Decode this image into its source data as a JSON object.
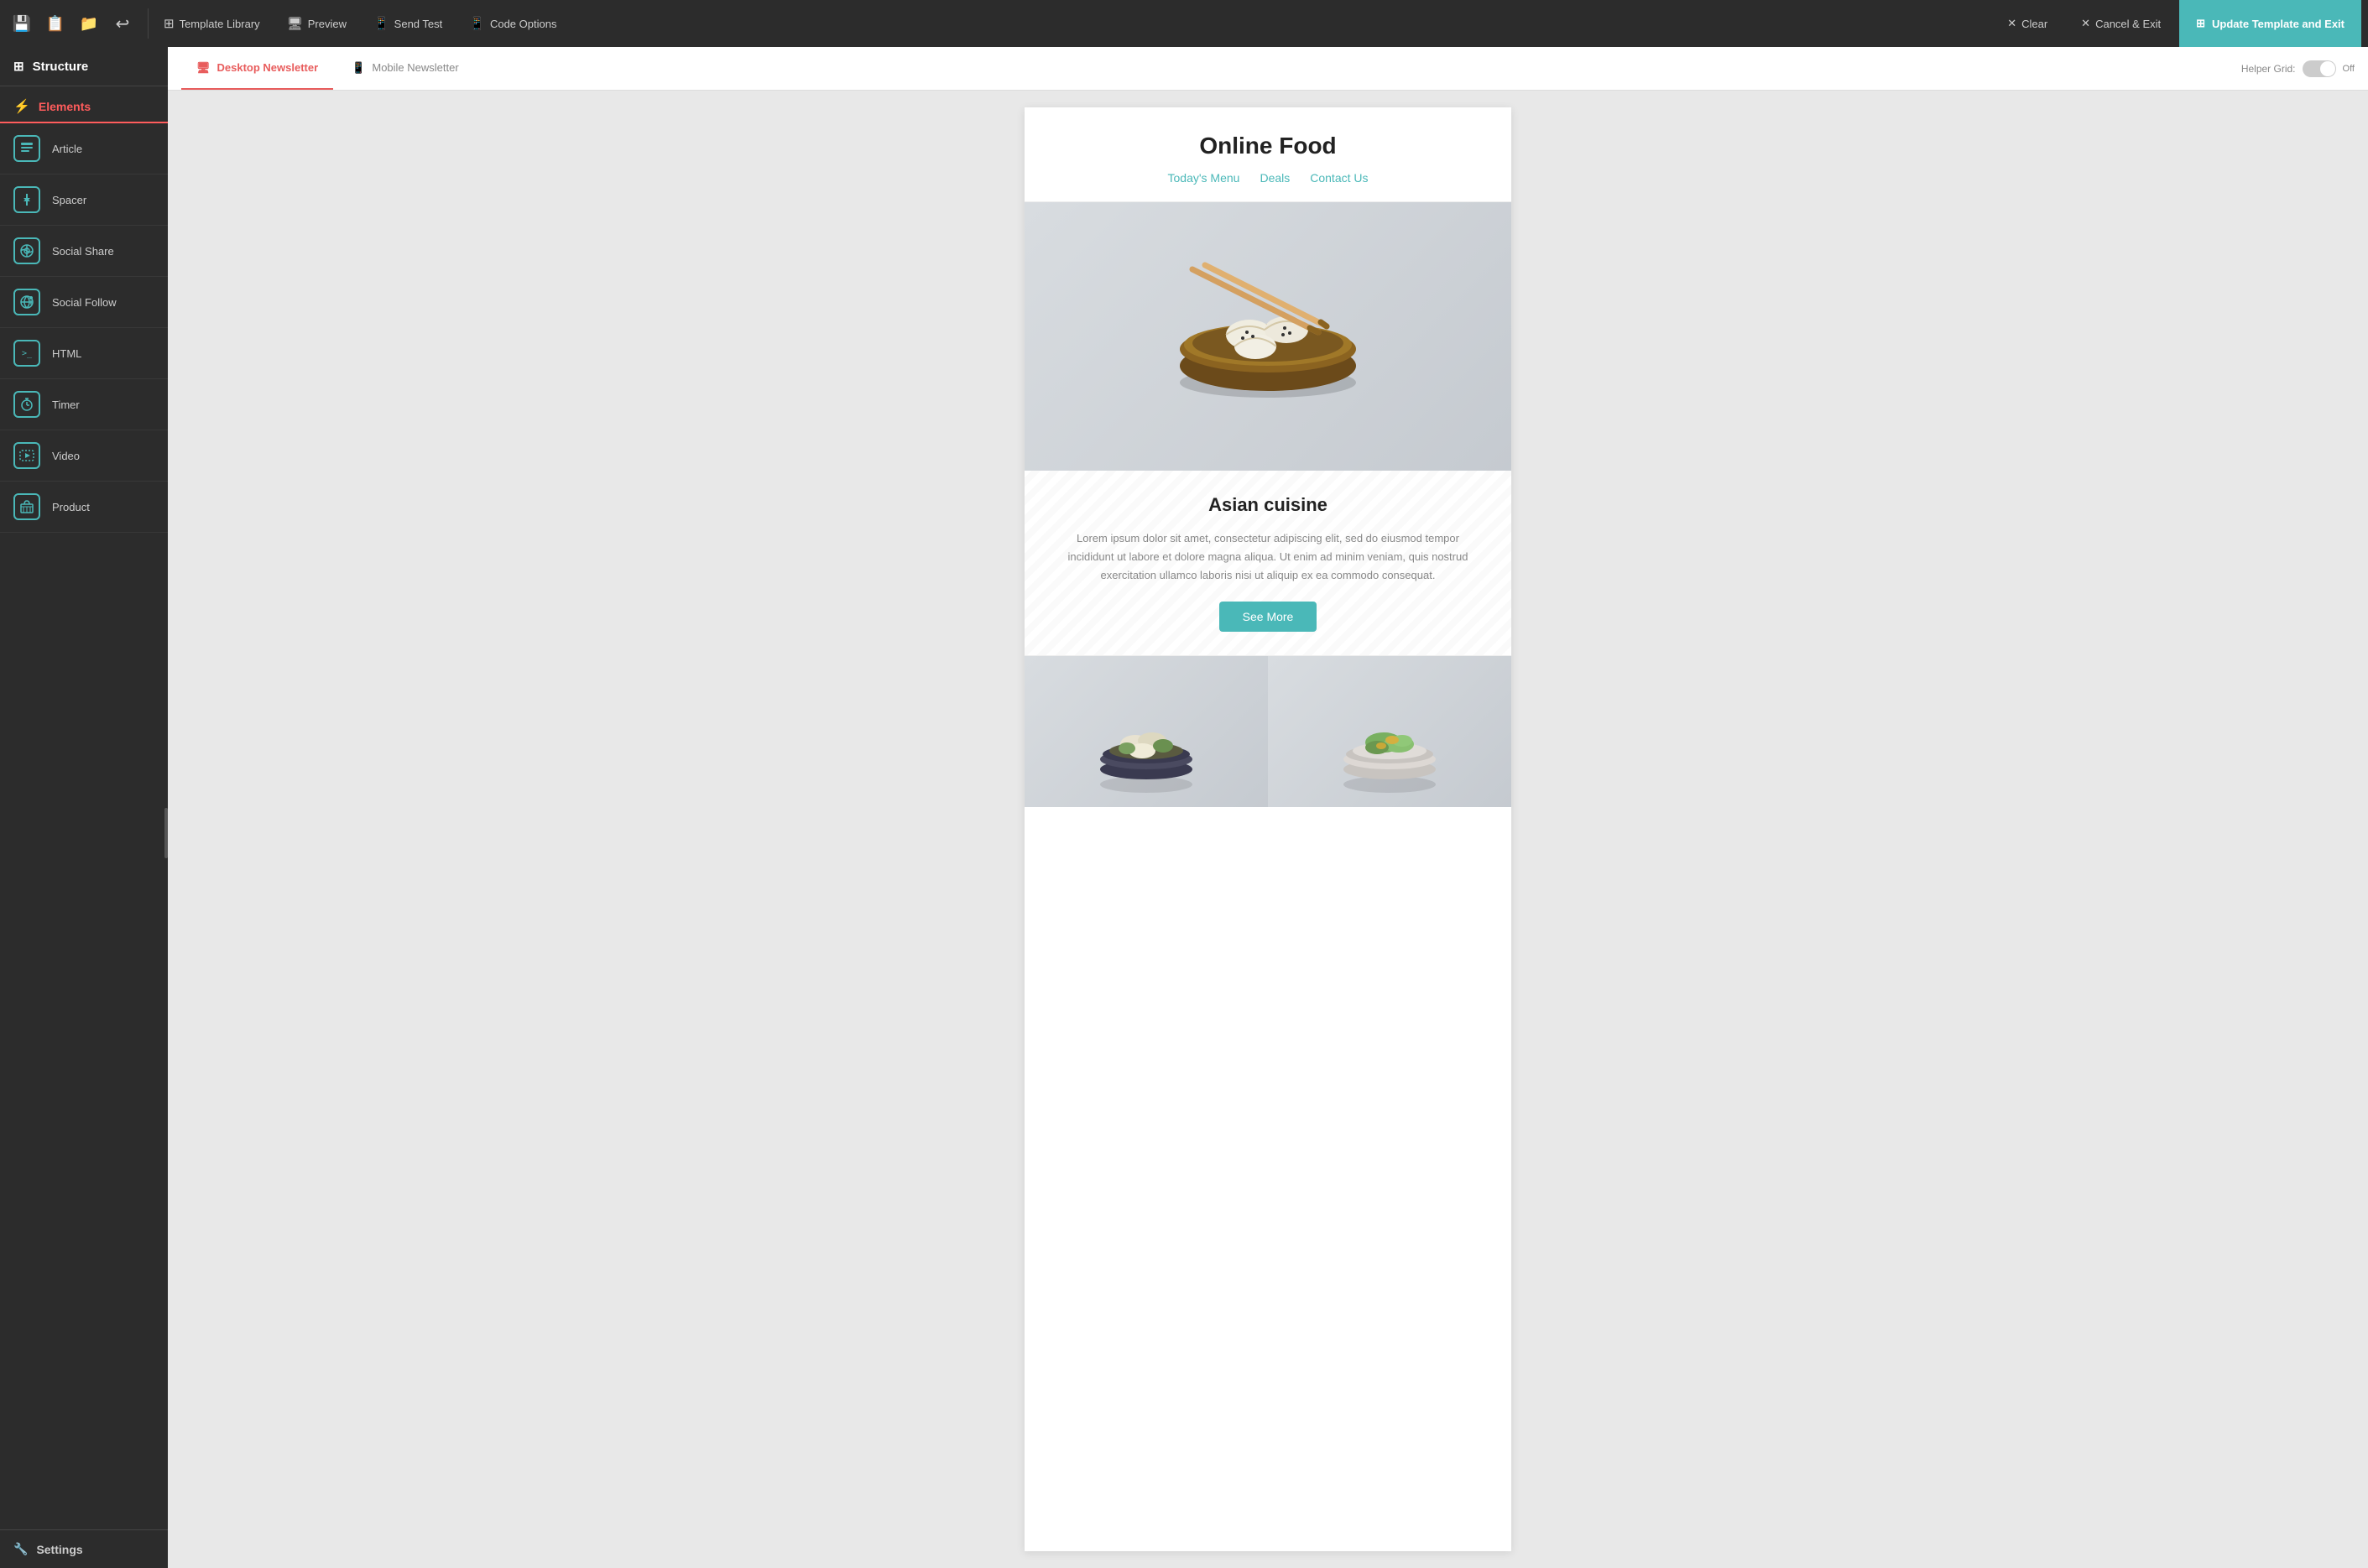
{
  "toolbar": {
    "icons": [
      "save1",
      "save2",
      "folder"
    ],
    "undo_label": "↩",
    "template_library_label": "Template Library",
    "preview_label": "Preview",
    "send_test_label": "Send Test",
    "code_options_label": "Code Options",
    "clear_label": "Clear",
    "cancel_label": "Cancel & Exit",
    "update_label": "Update Template and Exit"
  },
  "sidebar": {
    "header_label": "Structure",
    "section_label": "Elements",
    "items": [
      {
        "id": "article",
        "label": "Article",
        "icon": "📰"
      },
      {
        "id": "spacer",
        "label": "Spacer",
        "icon": "↕"
      },
      {
        "id": "social-share",
        "label": "Social Share",
        "icon": "◎"
      },
      {
        "id": "social-follow",
        "label": "Social Follow",
        "icon": "⊕"
      },
      {
        "id": "html",
        "label": "HTML",
        "icon": ">_"
      },
      {
        "id": "timer",
        "label": "Timer",
        "icon": "⏱"
      },
      {
        "id": "video",
        "label": "Video",
        "icon": "▶"
      },
      {
        "id": "product",
        "label": "Product",
        "icon": "🏷"
      }
    ],
    "settings_label": "Settings",
    "settings_icon": "🔧"
  },
  "tabs": {
    "desktop_label": "Desktop Newsletter",
    "mobile_label": "Mobile Newsletter",
    "helper_grid_label": "Helper Grid:",
    "toggle_state": "Off"
  },
  "email": {
    "title": "Online Food",
    "nav": [
      {
        "label": "Today's Menu"
      },
      {
        "label": "Deals"
      },
      {
        "label": "Contact Us"
      }
    ],
    "article": {
      "title": "Asian cuisine",
      "body": "Lorem ipsum dolor sit amet, consectetur adipiscing elit, sed do eiusmod tempor incididunt ut labore et dolore magna aliqua. Ut enim ad minim veniam, quis nostrud exercitation ullamco laboris nisi ut aliquip ex ea commodo consequat.",
      "button_label": "See More"
    },
    "grid_items": [
      {
        "id": "grid-left"
      },
      {
        "id": "grid-right"
      }
    ]
  }
}
